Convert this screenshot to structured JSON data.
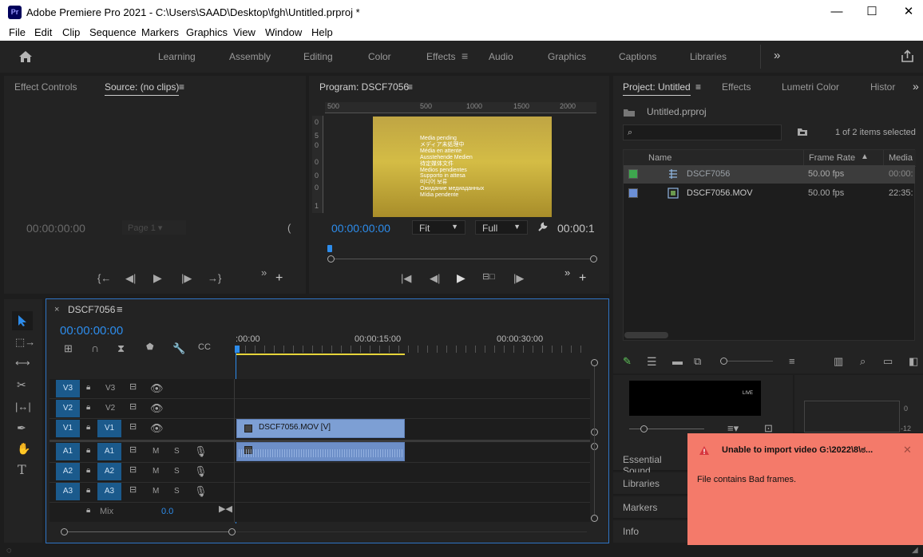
{
  "window": {
    "app_icon": "Pr",
    "title": "Adobe Premiere Pro 2021 - C:\\Users\\SAAD\\Desktop\\fgh\\Untitled.prproj *",
    "minimize": "—",
    "maximize": "☐",
    "close": "✕"
  },
  "menu": [
    "File",
    "Edit",
    "Clip",
    "Sequence",
    "Markers",
    "Graphics",
    "View",
    "Window",
    "Help"
  ],
  "workspaces": [
    "Learning",
    "Assembly",
    "Editing",
    "Color",
    "Effects",
    "Audio",
    "Graphics",
    "Captions",
    "Libraries"
  ],
  "workspaces_active": "Effects",
  "source_panel": {
    "tabs": [
      "Effect Controls",
      "Source: (no clips)"
    ],
    "timecode": "00:00:00:00",
    "page": "Page 1"
  },
  "program_panel": {
    "tab": "Program: DSCF7056",
    "ruler_ticks": [
      "500",
      "500",
      "1000",
      "1500",
      "2000"
    ],
    "v_ruler": [
      "0",
      "5",
      "0",
      "0",
      "0",
      "0",
      "1"
    ],
    "media_pending": [
      "Media pending",
      "メディア未処理中",
      "Média en attente",
      "Ausstehende Medien",
      "待定媒体文件",
      "Medios pendientes",
      "Supporto in attesa",
      "미디어 보류",
      "Ожидание медиаданных",
      "Mídia pendente"
    ],
    "timecode": "00:00:00:00",
    "zoom": "Fit",
    "quality": "Full",
    "duration": "00:00:1"
  },
  "project_panel": {
    "tabs": [
      "Project: Untitled",
      "Effects",
      "Lumetri Color",
      "Histor"
    ],
    "project_file": "Untitled.prproj",
    "search_placeholder": "",
    "items_selected": "1 of 2 items selected",
    "columns": [
      "Name",
      "Frame Rate",
      "Media"
    ],
    "rows": [
      {
        "name": "DSCF7056",
        "fps": "50.00 fps",
        "media": "00:00:",
        "color": "#3ea64e"
      },
      {
        "name": "DSCF7056.MOV",
        "fps": "50.00 fps",
        "media": "22:35:",
        "color": "#6b8fd6"
      }
    ]
  },
  "timeline": {
    "sequence": "DSCF7056",
    "timecode": "00:00:00:00",
    "ruler": [
      ":00:00",
      "00:00:15:00",
      "00:00:30:00"
    ],
    "video_tracks": [
      {
        "src": "V3",
        "tgt": "V3"
      },
      {
        "src": "V2",
        "tgt": "V2"
      },
      {
        "src": "V1",
        "tgt": "V1"
      }
    ],
    "audio_tracks": [
      {
        "src": "A1",
        "tgt": "A1"
      },
      {
        "src": "A2",
        "tgt": "A2"
      },
      {
        "src": "A3",
        "tgt": "A3"
      }
    ],
    "mute": "M",
    "solo": "S",
    "mix_label": "Mix",
    "mix_value": "0.0",
    "video_clip": "DSCF7056.MOV [V]"
  },
  "side_panels": [
    "Essential Sound",
    "Libraries",
    "Markers",
    "Info"
  ],
  "live_label": "LIVE",
  "meter_ticks": [
    "0",
    "-12"
  ],
  "toast": {
    "title": "Unable to import video G:\\2022\\8\\ಠ...",
    "message": "File contains Bad frames.",
    "close": "✕"
  }
}
